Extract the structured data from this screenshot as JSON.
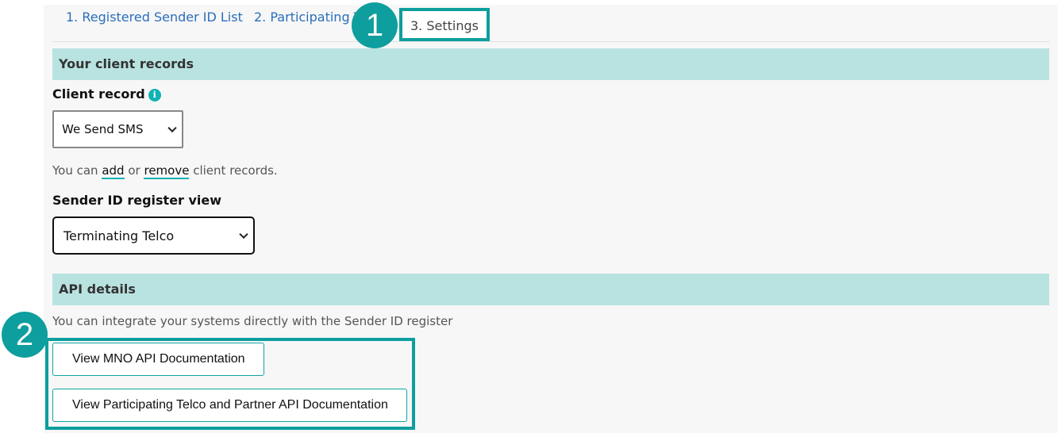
{
  "tabs": [
    {
      "label": "1. Registered Sender ID List"
    },
    {
      "label": "2. Participating T"
    },
    {
      "label": "3. Settings"
    }
  ],
  "client_records": {
    "header": "Your client records",
    "label": "Client record",
    "info_icon": "i",
    "selected": "We Send SMS",
    "help_prefix": "You can ",
    "help_add": "add",
    "help_or": " or ",
    "help_remove": "remove",
    "help_suffix": " client records."
  },
  "register_view": {
    "label": "Sender ID register view",
    "selected": "Terminating Telco"
  },
  "api": {
    "header": "API details",
    "description": "You can integrate your systems directly with the Sender ID register",
    "buttons": [
      {
        "label": "View MNO API Documentation"
      },
      {
        "label": "View Participating Telco and Partner API Documentation"
      }
    ]
  },
  "callouts": [
    "1",
    "2"
  ],
  "colors": {
    "accent": "#0e9e9e",
    "header_bg": "#b9e3e1",
    "link": "#2a6ebb"
  }
}
